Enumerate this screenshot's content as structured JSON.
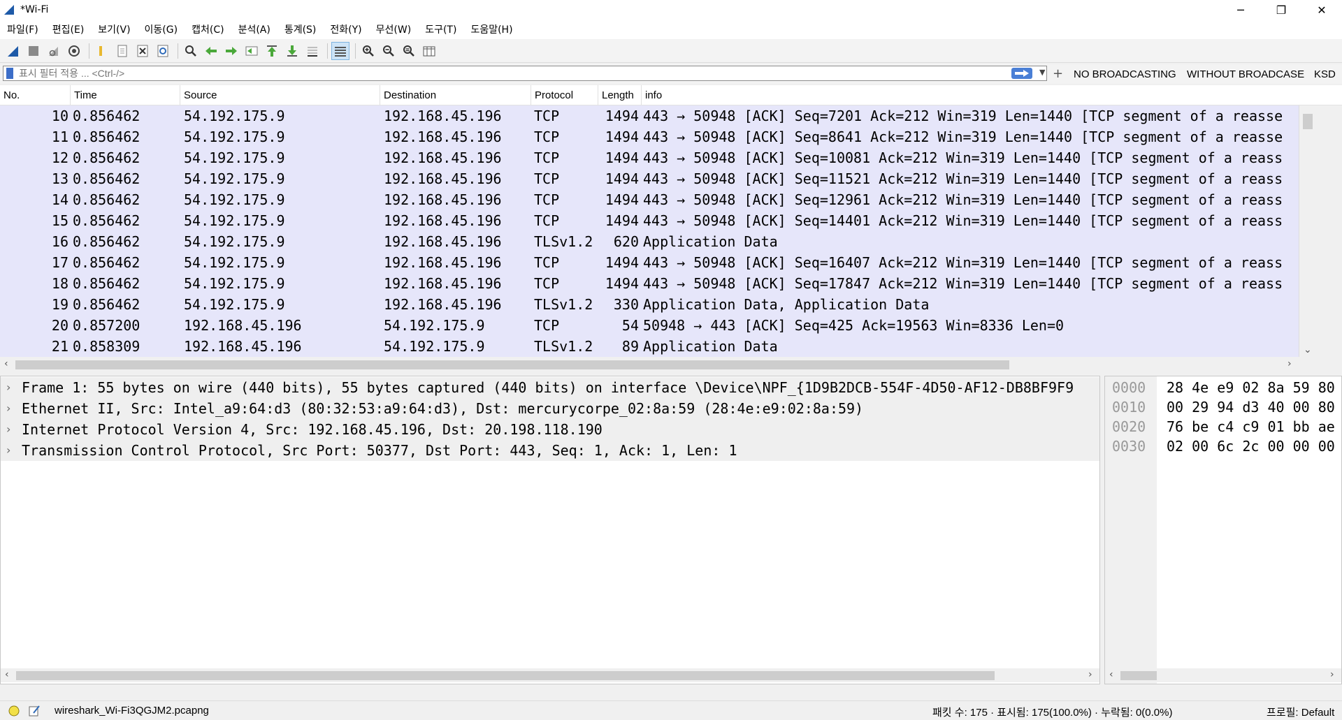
{
  "window": {
    "title": "*Wi-Fi",
    "minimize": "─",
    "maximize": "❐",
    "close": "✕"
  },
  "menu": [
    "파일(F)",
    "편집(E)",
    "보기(V)",
    "이동(G)",
    "캡처(C)",
    "분석(A)",
    "통계(S)",
    "전화(Y)",
    "무선(W)",
    "도구(T)",
    "도움말(H)"
  ],
  "filter": {
    "placeholder": "표시 필터 적용 ... <Ctrl-/>",
    "plus": "+",
    "buttons": [
      "NO BROADCASTING",
      "WITHOUT BROADCASE",
      "KSD"
    ]
  },
  "columns": [
    "No.",
    "Time",
    "Source",
    "Destination",
    "Protocol",
    "Length",
    "info"
  ],
  "packets": [
    {
      "no": "10",
      "time": "0.856462",
      "src": "54.192.175.9",
      "dst": "192.168.45.196",
      "proto": "TCP",
      "len": "1494",
      "info": "443 → 50948 [ACK] Seq=7201 Ack=212 Win=319 Len=1440 [TCP segment of a reasse"
    },
    {
      "no": "11",
      "time": "0.856462",
      "src": "54.192.175.9",
      "dst": "192.168.45.196",
      "proto": "TCP",
      "len": "1494",
      "info": "443 → 50948 [ACK] Seq=8641 Ack=212 Win=319 Len=1440 [TCP segment of a reasse"
    },
    {
      "no": "12",
      "time": "0.856462",
      "src": "54.192.175.9",
      "dst": "192.168.45.196",
      "proto": "TCP",
      "len": "1494",
      "info": "443 → 50948 [ACK] Seq=10081 Ack=212 Win=319 Len=1440 [TCP segment of a reass"
    },
    {
      "no": "13",
      "time": "0.856462",
      "src": "54.192.175.9",
      "dst": "192.168.45.196",
      "proto": "TCP",
      "len": "1494",
      "info": "443 → 50948 [ACK] Seq=11521 Ack=212 Win=319 Len=1440 [TCP segment of a reass"
    },
    {
      "no": "14",
      "time": "0.856462",
      "src": "54.192.175.9",
      "dst": "192.168.45.196",
      "proto": "TCP",
      "len": "1494",
      "info": "443 → 50948 [ACK] Seq=12961 Ack=212 Win=319 Len=1440 [TCP segment of a reass"
    },
    {
      "no": "15",
      "time": "0.856462",
      "src": "54.192.175.9",
      "dst": "192.168.45.196",
      "proto": "TCP",
      "len": "1494",
      "info": "443 → 50948 [ACK] Seq=14401 Ack=212 Win=319 Len=1440 [TCP segment of a reass"
    },
    {
      "no": "16",
      "time": "0.856462",
      "src": "54.192.175.9",
      "dst": "192.168.45.196",
      "proto": "TLSv1.2",
      "len": "620",
      "info": "Application Data"
    },
    {
      "no": "17",
      "time": "0.856462",
      "src": "54.192.175.9",
      "dst": "192.168.45.196",
      "proto": "TCP",
      "len": "1494",
      "info": "443 → 50948 [ACK] Seq=16407 Ack=212 Win=319 Len=1440 [TCP segment of a reass"
    },
    {
      "no": "18",
      "time": "0.856462",
      "src": "54.192.175.9",
      "dst": "192.168.45.196",
      "proto": "TCP",
      "len": "1494",
      "info": "443 → 50948 [ACK] Seq=17847 Ack=212 Win=319 Len=1440 [TCP segment of a reass"
    },
    {
      "no": "19",
      "time": "0.856462",
      "src": "54.192.175.9",
      "dst": "192.168.45.196",
      "proto": "TLSv1.2",
      "len": "330",
      "info": "Application Data, Application Data"
    },
    {
      "no": "20",
      "time": "0.857200",
      "src": "192.168.45.196",
      "dst": "54.192.175.9",
      "proto": "TCP",
      "len": "54",
      "info": "50948 → 443 [ACK] Seq=425 Ack=19563 Win=8336 Len=0"
    },
    {
      "no": "21",
      "time": "0.858309",
      "src": "192.168.45.196",
      "dst": "54.192.175.9",
      "proto": "TLSv1.2",
      "len": "89",
      "info": "Application Data"
    }
  ],
  "details": [
    "Frame 1: 55 bytes on wire (440 bits), 55 bytes captured (440 bits) on interface \\Device\\NPF_{1D9B2DCB-554F-4D50-AF12-DB8BF9F9",
    "Ethernet II, Src: Intel_a9:64:d3 (80:32:53:a9:64:d3), Dst: mercurycorpe_02:8a:59 (28:4e:e9:02:8a:59)",
    "Internet Protocol Version 4, Src: 192.168.45.196, Dst: 20.198.118.190",
    "Transmission Control Protocol, Src Port: 50377, Dst Port: 443, Seq: 1, Ack: 1, Len: 1"
  ],
  "hex": [
    {
      "offset": "0000",
      "bytes": "28 4e e9 02 8a 59 80"
    },
    {
      "offset": "0010",
      "bytes": "00 29 94 d3 40 00 80"
    },
    {
      "offset": "0020",
      "bytes": "76 be c4 c9 01 bb ae"
    },
    {
      "offset": "0030",
      "bytes": "02 00 6c 2c 00 00 00"
    }
  ],
  "status": {
    "file": "wireshark_Wi-Fi3QGJM2.pcapng",
    "packets": "패킷 수: 175 · 표시됨: 175(100.0%) · 누락됨: 0(0.0%)",
    "profile": "프로필: Default"
  },
  "colors": {
    "packet_bg": "#e6e6fa",
    "accent": "#3c6ec8",
    "shark_fin": "#1e5aa8"
  }
}
